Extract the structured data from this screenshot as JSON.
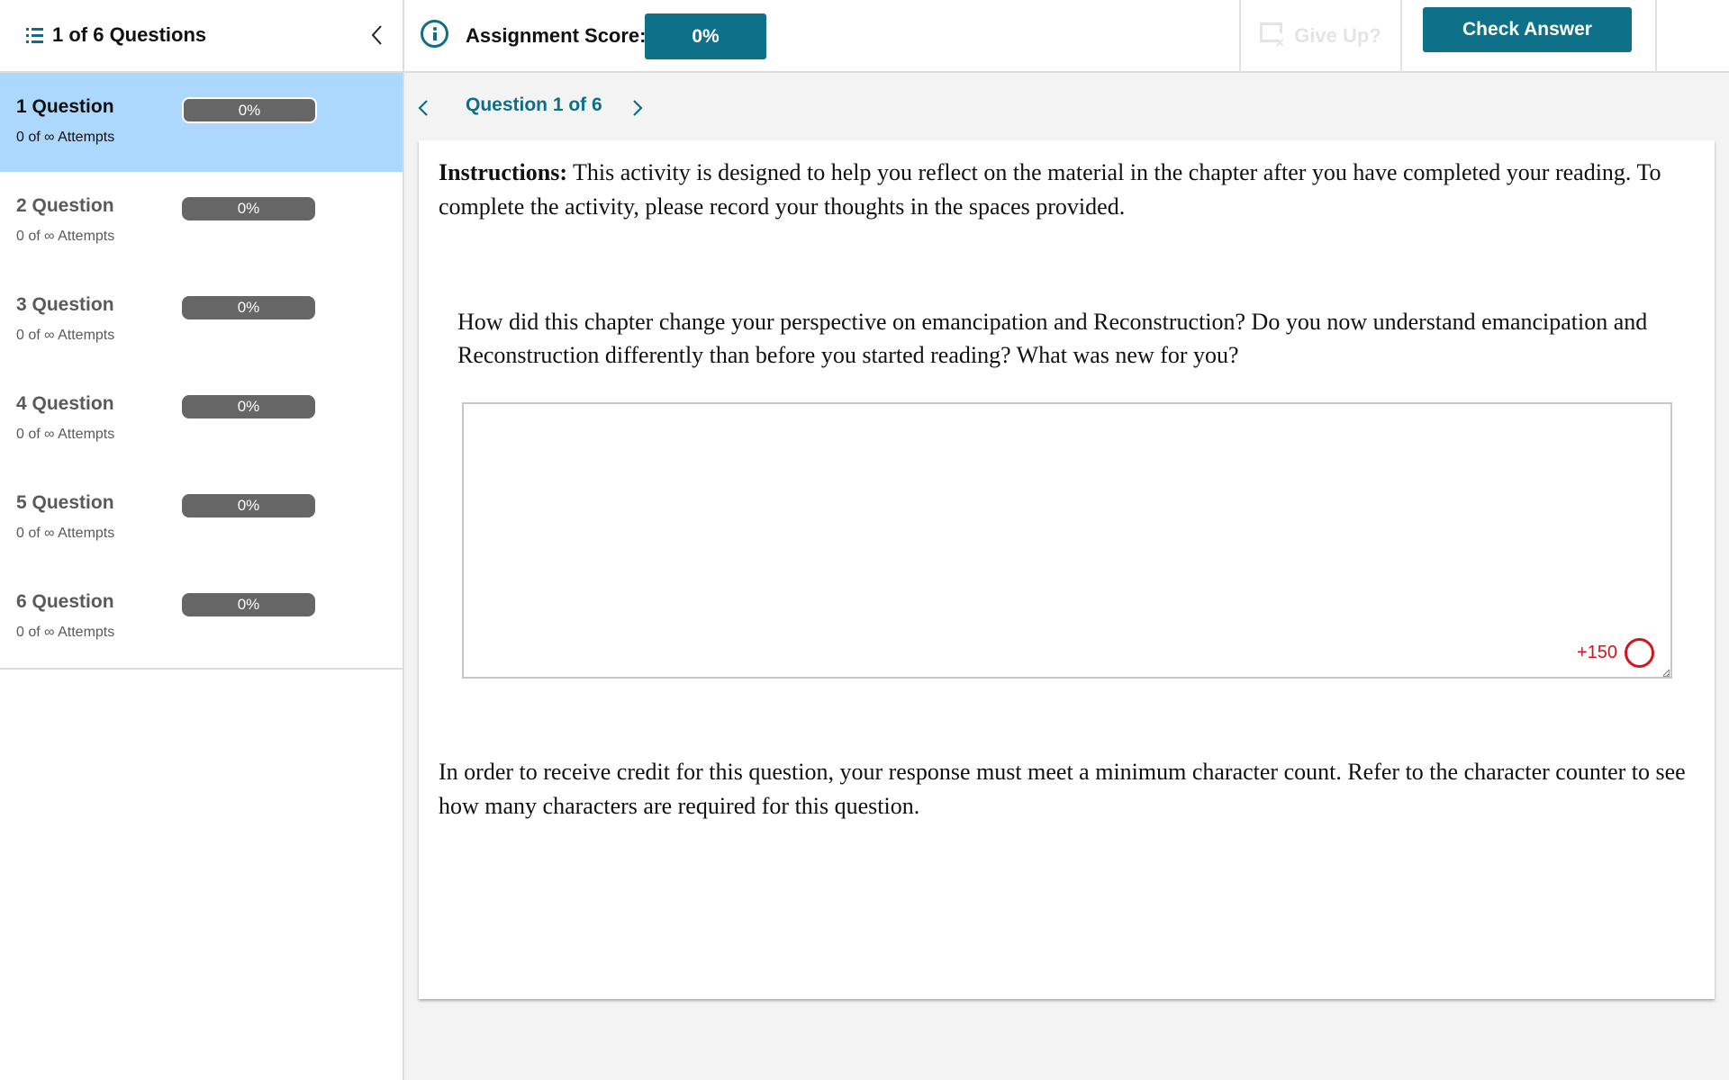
{
  "header": {
    "sidebar_title": "1 of 6 Questions",
    "score_label": "Assignment Score:",
    "score_value": "0%",
    "give_up_label": "Give Up?",
    "check_answer_label": "Check Answer"
  },
  "icons": {
    "list": "list-icon",
    "collapse": "chevron-left-icon",
    "info": "info-icon",
    "give_up": "give-up-icon",
    "prev": "chevron-left-icon",
    "next": "chevron-right-icon"
  },
  "colors": {
    "accent": "#0e7089",
    "active_item_bg": "#acd8fd",
    "progress_pill": "#666666",
    "counter_red": "#d2161e"
  },
  "sidebar": {
    "items": [
      {
        "title": "1 Question",
        "attempts": "0 of ∞ Attempts",
        "score": "0%",
        "active": true
      },
      {
        "title": "2 Question",
        "attempts": "0 of ∞ Attempts",
        "score": "0%",
        "active": false
      },
      {
        "title": "3 Question",
        "attempts": "0 of ∞ Attempts",
        "score": "0%",
        "active": false
      },
      {
        "title": "4 Question",
        "attempts": "0 of ∞ Attempts",
        "score": "0%",
        "active": false
      },
      {
        "title": "5 Question",
        "attempts": "0 of ∞ Attempts",
        "score": "0%",
        "active": false
      },
      {
        "title": "6 Question",
        "attempts": "0 of ∞ Attempts",
        "score": "0%",
        "active": false
      }
    ]
  },
  "main": {
    "nav_label": "Question 1 of 6",
    "instructions_label": "Instructions:",
    "instructions_text": " This activity is designed to help you reflect on the material in the chapter after you have completed your reading. To complete the activity, please record your thoughts in the spaces provided.",
    "question_text": "How did this chapter change your perspective on emancipation and Reconstruction? Do you now understand emancipation and Reconstruction differently than before you started reading? What was new for you?",
    "answer_value": "",
    "answer_placeholder": "",
    "char_counter": "+150",
    "footnote": "In order to receive credit for this question, your response must meet a minimum character count. Refer to the character counter to see how many characters are required for this question."
  }
}
